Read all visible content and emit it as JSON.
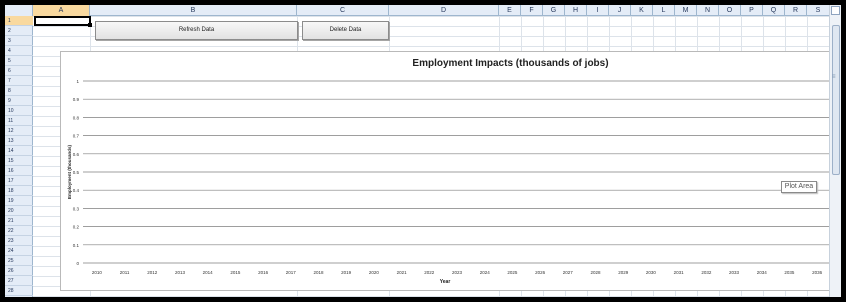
{
  "spreadsheet": {
    "columns": [
      "A",
      "B",
      "C",
      "D",
      "E",
      "F",
      "G",
      "H",
      "I",
      "J",
      "K",
      "L",
      "M",
      "N",
      "O",
      "P",
      "Q",
      "R",
      "S"
    ],
    "selected_column": "A",
    "rows": [
      "1",
      "2",
      "3",
      "4",
      "5",
      "6",
      "7",
      "8",
      "9",
      "10",
      "11",
      "12",
      "13",
      "14",
      "15",
      "16",
      "17",
      "18",
      "19",
      "20",
      "21",
      "22",
      "23",
      "24",
      "25",
      "26",
      "27",
      "28"
    ],
    "selected_row": "1"
  },
  "buttons": {
    "refresh_label": "Refresh Data",
    "delete_label": "Delete Data"
  },
  "tooltip": {
    "plot_area": "Plot Area"
  },
  "chart_data": {
    "type": "line",
    "title": "Employment Impacts (thousands of jobs)",
    "xlabel": "Year",
    "ylabel": "Employment (thousands)",
    "x": [
      "2010",
      "2011",
      "2012",
      "2013",
      "2014",
      "2015",
      "2016",
      "2017",
      "2018",
      "2019",
      "2020",
      "2021",
      "2022",
      "2023",
      "2024",
      "2025",
      "2026",
      "2027",
      "2028",
      "2029",
      "2030",
      "2031",
      "2032",
      "2033",
      "2034",
      "2035",
      "2036"
    ],
    "yticks": [
      "0",
      "0.1",
      "0.2",
      "0.3",
      "0.4",
      "0.5",
      "0.6",
      "0.7",
      "0.8",
      "0.9",
      "1"
    ],
    "ylim": [
      0,
      1
    ],
    "series": [],
    "grid": true
  },
  "colors": {
    "header_bg": "#e4ecf7",
    "header_selected": "#f9d99f",
    "gridline": "#dde3ea"
  }
}
